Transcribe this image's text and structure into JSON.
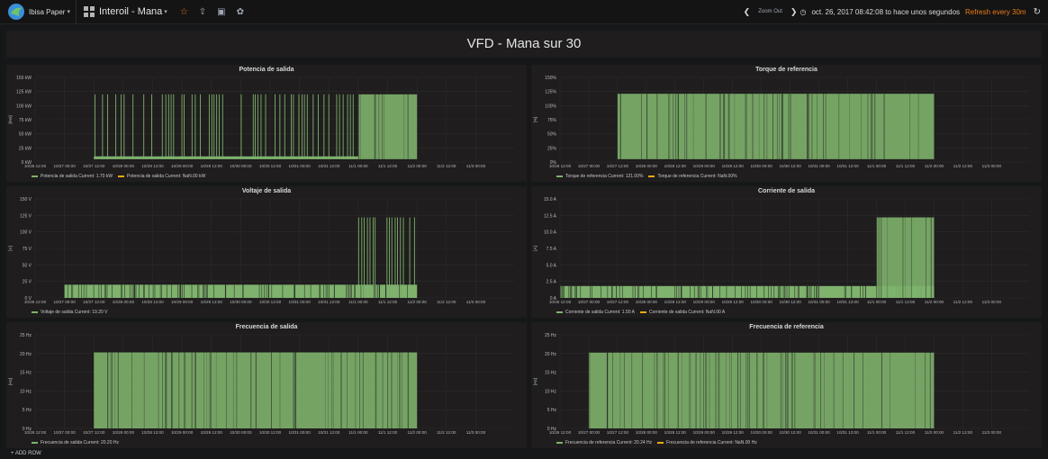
{
  "navbar": {
    "org": "Ibisa Paper",
    "dashboard": "Interoil - Mana",
    "zoom_out": "Zoom Out",
    "time_range": "oct. 26, 2017 08:42:08 to hace unos segundos",
    "refresh": "Refresh every 30m"
  },
  "row_title": "VFD - Mana sur 30",
  "add_row": "ADD ROW",
  "colors": {
    "series": "#7eb26d",
    "series2": "#e5ac0e",
    "background": "#1f1d1d",
    "accent": "#eb7b18"
  },
  "x_ticks": [
    "10/26 12:00",
    "10/27 00:00",
    "10/27 12:00",
    "10/28 00:00",
    "10/28 12:00",
    "10/29 00:00",
    "10/29 12:00",
    "10/30 00:00",
    "10/30 12:00",
    "10/31 00:00",
    "10/31 12:00",
    "11/1 00:00",
    "11/1 12:00",
    "11/2 00:00",
    "11/2 12:00",
    "11/3 00:00"
  ],
  "panels": [
    {
      "title": "Potencia de salida",
      "unit_label": "[kW]",
      "y_ticks": [
        "150 kW",
        "125 kW",
        "100 kW",
        "75 kW",
        "50 kW",
        "25 kW",
        "0 kW"
      ],
      "legend": [
        {
          "text": "Potencia de salida  Current: 1.70 kW",
          "color": "#7eb26d"
        },
        {
          "text": "Potencia de salida  Current: NaN.00 kW",
          "color": "#e5ac0e"
        }
      ]
    },
    {
      "title": "Torque de referencia",
      "unit_label": "[%]",
      "y_ticks": [
        "150%",
        "125%",
        "100%",
        "75%",
        "50%",
        "25%",
        "0%"
      ],
      "legend": [
        {
          "text": "Torque de referencia  Current: 121.00%",
          "color": "#7eb26d"
        },
        {
          "text": "Torque de referencia  Current: NaN.00%",
          "color": "#e5ac0e"
        }
      ]
    },
    {
      "title": "Voltaje de salida",
      "unit_label": "[V]",
      "y_ticks": [
        "150 V",
        "125 V",
        "100 V",
        "75 V",
        "50 V",
        "25 V",
        "0 V"
      ],
      "legend": [
        {
          "text": "Voltaje de salida  Current: 19.20 V",
          "color": "#7eb26d"
        }
      ]
    },
    {
      "title": "Corriente de salida",
      "unit_label": "[A]",
      "y_ticks": [
        "15.0 A",
        "12.5 A",
        "10.0 A",
        "7.5 A",
        "5.0 A",
        "2.5 A",
        "0 A"
      ],
      "legend": [
        {
          "text": "Corriente de salida  Current: 1.50 A",
          "color": "#7eb26d"
        },
        {
          "text": "Corriente de salida  Current: NaN.00 A",
          "color": "#e5ac0e"
        }
      ]
    },
    {
      "title": "Frecuencia de salida",
      "unit_label": "[Hz]",
      "y_ticks": [
        "25 Hz",
        "20 Hz",
        "15 Hz",
        "10 Hz",
        "5 Hz",
        "0 Hz"
      ],
      "legend": [
        {
          "text": "Frecuencia de salida  Current: 20.20 Hz",
          "color": "#7eb26d"
        }
      ]
    },
    {
      "title": "Frecuencia de referencia",
      "unit_label": "[Hz]",
      "y_ticks": [
        "25 Hz",
        "20 Hz",
        "15 Hz",
        "10 Hz",
        "5 Hz",
        "0 Hz"
      ],
      "legend": [
        {
          "text": "Frecuencia de referencia  Current: 20.24 Hz",
          "color": "#7eb26d"
        },
        {
          "text": "Frecuencia de referencia  Current: NaN.00 Hz",
          "color": "#e5ac0e"
        }
      ]
    }
  ],
  "chart_data": [
    {
      "type": "area",
      "title": "Potencia de salida",
      "ylim": [
        0,
        150
      ],
      "x_range": [
        "10/26 12:00",
        "11/3 00:00"
      ],
      "series": [
        {
          "name": "Potencia de salida",
          "segments": [
            {
              "from": "10/27 12:00",
              "to": "11/1 00:00",
              "low": 5,
              "high": 120,
              "baseline": 10,
              "pattern": "spikes"
            },
            {
              "from": "11/1 00:00",
              "to": "11/2 00:00",
              "low": 5,
              "high": 120,
              "pattern": "dense"
            }
          ]
        }
      ]
    },
    {
      "type": "area",
      "title": "Torque de referencia",
      "ylim": [
        0,
        150
      ],
      "x_range": [
        "10/26 12:00",
        "11/3 00:00"
      ],
      "series": [
        {
          "name": "Torque de referencia",
          "segments": [
            {
              "from": "10/27 12:00",
              "to": "11/2 00:00",
              "low": 5,
              "high": 121,
              "pattern": "dense"
            }
          ]
        }
      ]
    },
    {
      "type": "area",
      "title": "Voltaje de salida",
      "ylim": [
        0,
        150
      ],
      "x_range": [
        "10/26 12:00",
        "11/3 00:00"
      ],
      "series": [
        {
          "name": "Voltaje de salida",
          "segments": [
            {
              "from": "10/27 00:00",
              "to": "11/2 00:00",
              "low": 0,
              "high": 20,
              "baseline": 12,
              "pattern": "baseline"
            },
            {
              "from": "11/1 00:00",
              "to": "11/2 00:00",
              "low": 0,
              "high": 122,
              "pattern": "spikes"
            }
          ]
        }
      ]
    },
    {
      "type": "area",
      "title": "Corriente de salida",
      "ylim": [
        0,
        15
      ],
      "x_range": [
        "10/26 12:00",
        "11/3 00:00"
      ],
      "series": [
        {
          "name": "Corriente de salida",
          "segments": [
            {
              "from": "10/26 12:00",
              "to": "11/2 00:00",
              "low": 0,
              "high": 1.8,
              "baseline": 1.5,
              "pattern": "baseline"
            },
            {
              "from": "11/1 00:00",
              "to": "11/2 00:00",
              "low": 0,
              "high": 12.2,
              "pattern": "dense"
            }
          ]
        }
      ]
    },
    {
      "type": "area",
      "title": "Frecuencia de salida",
      "ylim": [
        0,
        25
      ],
      "x_range": [
        "10/26 12:00",
        "11/3 00:00"
      ],
      "series": [
        {
          "name": "Frecuencia de salida",
          "segments": [
            {
              "from": "10/27 12:00",
              "to": "11/2 00:00",
              "low": 0,
              "high": 20.3,
              "pattern": "dense"
            }
          ]
        }
      ]
    },
    {
      "type": "area",
      "title": "Frecuencia de referencia",
      "ylim": [
        0,
        25
      ],
      "x_range": [
        "10/26 12:00",
        "11/3 00:00"
      ],
      "series": [
        {
          "name": "Frecuencia de referencia",
          "segments": [
            {
              "from": "10/27 00:00",
              "to": "11/2 00:00",
              "low": 0,
              "high": 20.24,
              "pattern": "dense"
            }
          ]
        }
      ]
    }
  ]
}
